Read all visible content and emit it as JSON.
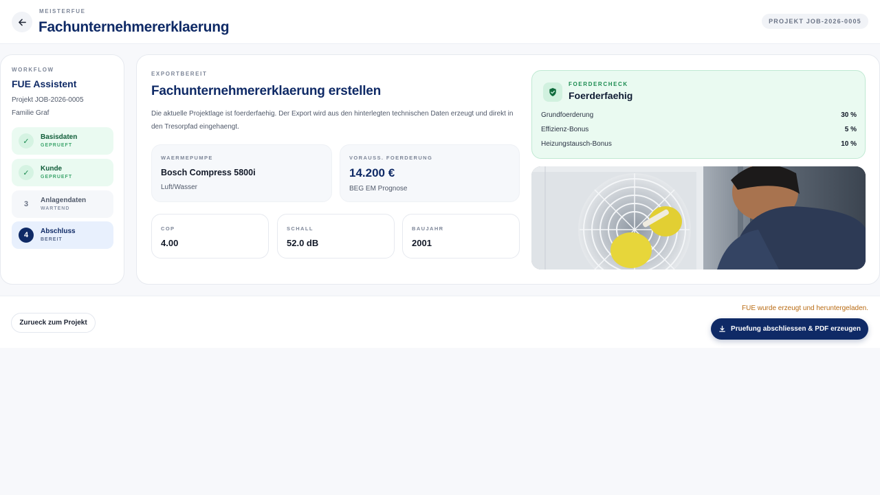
{
  "header": {
    "brand": "MEISTERFUE",
    "title": "Fachunternehmererklaerung",
    "project_pill": "PROJEKT JOB-2026-0005",
    "back_icon": "arrow-left-icon"
  },
  "sidebar": {
    "overline": "WORKFLOW",
    "title": "FUE Assistent",
    "project": "Projekt JOB-2026-0005",
    "customer": "Familie Graf",
    "steps": [
      {
        "badge": "✓",
        "label": "Basisdaten",
        "status": "GEPRUEFT",
        "state": "done"
      },
      {
        "badge": "✓",
        "label": "Kunde",
        "status": "GEPRUEFT",
        "state": "done"
      },
      {
        "badge": "3",
        "label": "Anlagendaten",
        "status": "WARTEND",
        "state": "pending"
      },
      {
        "badge": "4",
        "label": "Abschluss",
        "status": "BEREIT",
        "state": "active"
      }
    ]
  },
  "main": {
    "overline": "EXPORTBEREIT",
    "title": "Fachunternehmererklaerung erstellen",
    "description": "Die aktuelle Projektlage ist foerderfaehig. Der Export wird aus den hinterlegten technischen Daten erzeugt und direkt in den Tresorpfad eingehaengt.",
    "heat_pump": {
      "label": "WAERMEPUMPE",
      "value": "Bosch Compress 5800i",
      "sub": "Luft/Wasser"
    },
    "funding": {
      "label": "VORAUSS. FOERDERUNG",
      "value": "14.200 €",
      "sub": "BEG EM Prognose"
    },
    "metrics": [
      {
        "label": "COP",
        "value": "4.00"
      },
      {
        "label": "SCHALL",
        "value": "52.0 dB"
      },
      {
        "label": "BAUJAHR",
        "value": "2001"
      }
    ]
  },
  "check": {
    "overline": "FOERDERCHECK",
    "title": "Foerderfaehig",
    "icon": "shield-check-icon",
    "rows": [
      {
        "label": "Grundfoerderung",
        "value": "30 %"
      },
      {
        "label": "Effizienz-Bonus",
        "value": "5 %"
      },
      {
        "label": "Heizungstausch-Bonus",
        "value": "10 %"
      }
    ]
  },
  "footer": {
    "back_button": "Zurueck zum Projekt",
    "status_message": "FUE wurde erzeugt und heruntergeladen.",
    "primary_button": "Pruefung abschliessen & PDF erzeugen",
    "primary_icon": "download-icon"
  },
  "colors": {
    "brand_navy": "#0f2a66",
    "success_green": "#1a8a4f",
    "success_bg": "#eafaf1",
    "warning_text": "#b86a12"
  }
}
